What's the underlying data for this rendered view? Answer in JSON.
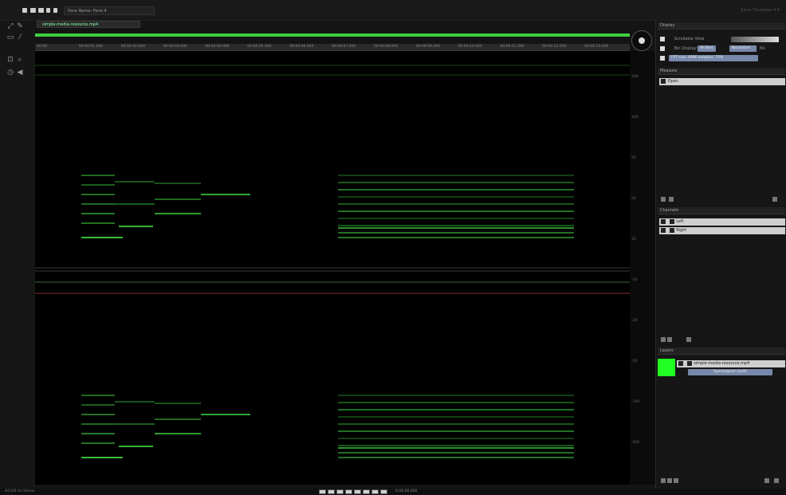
{
  "titlebar": {
    "pane_label": "Pane Name: Pane 4",
    "right_text": "Sonic Visualiser 4.4"
  },
  "file_tab": {
    "label": "simple-media-resource.mp4"
  },
  "time_bar": {
    "progress": 1.0
  },
  "time_ruler": {
    "labels": [
      "00:00",
      "00:00:01.000",
      "00:00:02.000",
      "00:00:03.000",
      "00:00:04.000",
      "00:00:05.000",
      "00:00:06.000",
      "00:00:07.000",
      "00:00:08.000",
      "00:00:09.000",
      "00:00:10.000",
      "00:00:11.000",
      "00:00:12.000",
      "00:00:13.000"
    ]
  },
  "freq_scale": {
    "ticks": [
      "200",
      "100",
      "50",
      "20",
      "10",
      "-10",
      "-20",
      "-50",
      "-100",
      "-200"
    ]
  },
  "sidebar": {
    "display": {
      "title": "Display",
      "scrollable_label": "Scrollable View",
      "bin_display_label": "Bin Display:",
      "bin_display_value": "All Bins",
      "normalize_label": "Normalize:",
      "normalize_value": "No",
      "colour_label": "FFT size: 4096 samples, 75%"
    },
    "measure": {
      "title": "Measure",
      "open_label": "Open"
    },
    "channels": {
      "title": "Channels",
      "items": [
        {
          "label": "Left"
        },
        {
          "label": "Right"
        }
      ]
    },
    "layers": {
      "title": "Layers",
      "layer_name": "simple-media-resource.mp4",
      "sub_label": "Spectrogram (Left)"
    }
  },
  "statusbar": {
    "text": "44100 Hz Stereo",
    "play_time": "0:00:00.000"
  },
  "colors": {
    "accent_green": "#3fcf3f",
    "spectro_bg": "#000000"
  }
}
